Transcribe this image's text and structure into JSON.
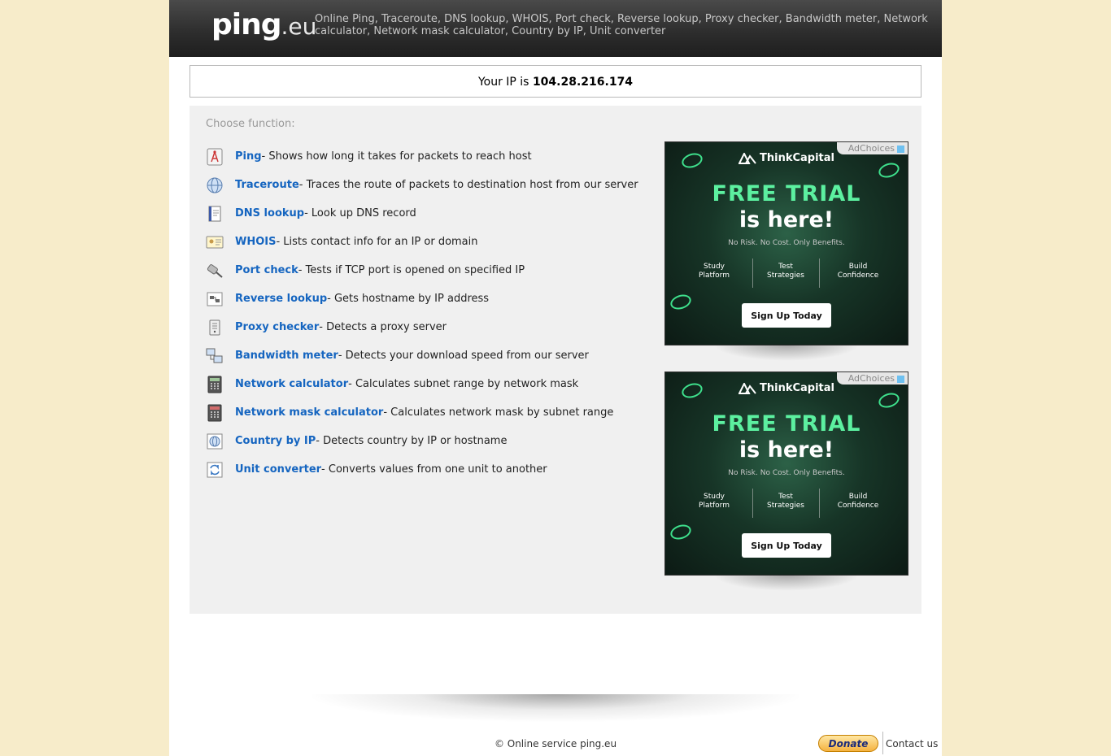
{
  "header": {
    "logo_main": "ping",
    "logo_tld": ".eu",
    "tagline": "Online Ping, Traceroute, DNS lookup, WHOIS, Port check, Reverse lookup, Proxy checker, Bandwidth meter, Network calculator, Network mask calculator, Country by IP, Unit converter"
  },
  "ip": {
    "label": "Your IP is",
    "value": "104.28.216.174"
  },
  "panel": {
    "heading": "Choose function:",
    "functions": [
      {
        "name": "Ping",
        "desc": " - Shows how long it takes for packets to reach host",
        "icon": "ping-icon"
      },
      {
        "name": "Traceroute",
        "desc": " - Traces the route of packets to destination host from our server",
        "icon": "globe-icon"
      },
      {
        "name": "DNS lookup",
        "desc": " - Look up DNS record",
        "icon": "dns-book-icon"
      },
      {
        "name": "WHOIS",
        "desc": " - Lists contact info for an IP or domain",
        "icon": "id-card-icon"
      },
      {
        "name": "Port check",
        "desc": " - Tests if TCP port is opened on specified IP",
        "icon": "plug-icon"
      },
      {
        "name": "Reverse lookup",
        "desc": " - Gets hostname by IP address",
        "icon": "network-icon"
      },
      {
        "name": "Proxy checker",
        "desc": " - Detects a proxy server",
        "icon": "server-icon"
      },
      {
        "name": "Bandwidth meter",
        "desc": " - Detects your download speed from our server",
        "icon": "computers-icon"
      },
      {
        "name": "Network calculator",
        "desc": " - Calculates subnet range by network mask",
        "icon": "calculator-icon"
      },
      {
        "name": "Network mask calculator",
        "desc": " - Calculates network mask by subnet range",
        "icon": "calculator-red-icon"
      },
      {
        "name": "Country by IP",
        "desc": " - Detects country by IP or hostname",
        "icon": "globe-search-icon"
      },
      {
        "name": "Unit converter",
        "desc": " - Converts values from one unit to another",
        "icon": "convert-icon"
      }
    ]
  },
  "ads": [
    {
      "choices": "AdChoices",
      "brand": "ThinkCapital",
      "headline1": "FREE TRIAL",
      "headline2": "is here!",
      "sub": "No Risk. No Cost. Only Benefits.",
      "features": [
        "Study\nPlatform",
        "Test\nStrategies",
        "Build\nConfidence"
      ],
      "cta": "Sign Up Today"
    },
    {
      "choices": "AdChoices",
      "brand": "ThinkCapital",
      "headline1": "FREE TRIAL",
      "headline2": "is here!",
      "sub": "No Risk. No Cost. Only Benefits.",
      "features": [
        "Study\nPlatform",
        "Test\nStrategies",
        "Build\nConfidence"
      ],
      "cta": "Sign Up Today"
    }
  ],
  "footer": {
    "copyright": "© Online service ping.eu",
    "donate": "Donate",
    "contact": "Contact us"
  },
  "colors": {
    "background": "#f7ecca",
    "link": "#1565c0",
    "panel": "#f0f0f0",
    "ad_accent": "#5cf0a0"
  }
}
